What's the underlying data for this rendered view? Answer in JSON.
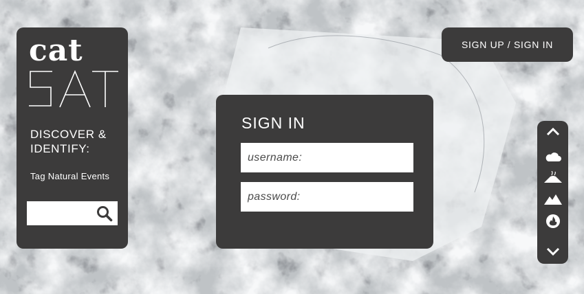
{
  "sidebar": {
    "logo_top": "cat",
    "logo_bottom": "SAT",
    "heading": "DISCOVER & IDENTIFY:",
    "tagline": "Tag Natural Events",
    "search": {
      "value": "",
      "icon": "search-icon"
    }
  },
  "header": {
    "auth_button": "SIGN UP / SIGN IN"
  },
  "signin": {
    "title": "SIGN IN",
    "username_placeholder": "username:",
    "password_placeholder": "password:"
  },
  "rail": {
    "icons": [
      "chevron-up-icon",
      "cloud-icon",
      "volcano-icon",
      "mountains-icon",
      "wildfire-icon",
      "chevron-down-icon"
    ]
  },
  "colors": {
    "panel": "#3c3b3b",
    "text": "#ffffff",
    "field": "#ffffff"
  }
}
